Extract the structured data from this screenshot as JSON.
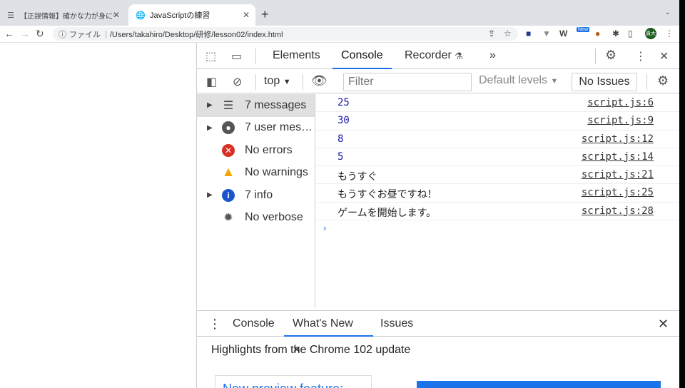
{
  "browser": {
    "tabs": [
      {
        "title": "【正誤情報】確かな力が身につくJ",
        "active": false
      },
      {
        "title": "JavaScriptの練習",
        "active": true
      }
    ],
    "url_scheme": "ファイル",
    "url": "/Users/takahiro/Desktop/研修/lesson02/index.html",
    "profile_label": "貴大",
    "ext_new_badge": "New"
  },
  "devtools": {
    "tabs": [
      "Elements",
      "Console",
      "Recorder"
    ],
    "active_tab": "Console",
    "more_tabs": "»",
    "context": "top",
    "filter_placeholder": "Filter",
    "levels": "Default levels",
    "issues_button": "No Issues",
    "sidebar": [
      {
        "label": "7 messages",
        "icon": "list-icon",
        "expandable": true,
        "selected": true
      },
      {
        "label": "7 user mes…",
        "icon": "user-icon",
        "expandable": true,
        "selected": false
      },
      {
        "label": "No errors",
        "icon": "error-icon",
        "expandable": false,
        "selected": false
      },
      {
        "label": "No warnings",
        "icon": "warning-icon",
        "expandable": false,
        "selected": false
      },
      {
        "label": "7 info",
        "icon": "info-icon",
        "expandable": true,
        "selected": false
      },
      {
        "label": "No verbose",
        "icon": "bug-icon",
        "expandable": false,
        "selected": false
      }
    ],
    "log": [
      {
        "value": "25",
        "type": "number",
        "source": "script.js:6"
      },
      {
        "value": "30",
        "type": "number",
        "source": "script.js:9"
      },
      {
        "value": "8",
        "type": "number",
        "source": "script.js:12"
      },
      {
        "value": "5",
        "type": "number",
        "source": "script.js:14"
      },
      {
        "value": "もうすぐ",
        "type": "string",
        "source": "script.js:21"
      },
      {
        "value": "もうすぐお昼ですね！",
        "type": "string",
        "source": "script.js:25"
      },
      {
        "value": "ゲームを開始します。",
        "type": "string",
        "source": "script.js:28"
      }
    ],
    "drawer": {
      "tabs": [
        "Console",
        "What's New",
        "Issues"
      ],
      "active_tab": "What's New",
      "highlights": "Highlights from the Chrome 102 update",
      "card_title": "New preview feature:"
    }
  },
  "colors": {
    "accent": "#1a73e8",
    "number_text": "#1a1aa6",
    "error": "#d93025",
    "warning": "#f2a600",
    "info": "#1a56c9"
  }
}
